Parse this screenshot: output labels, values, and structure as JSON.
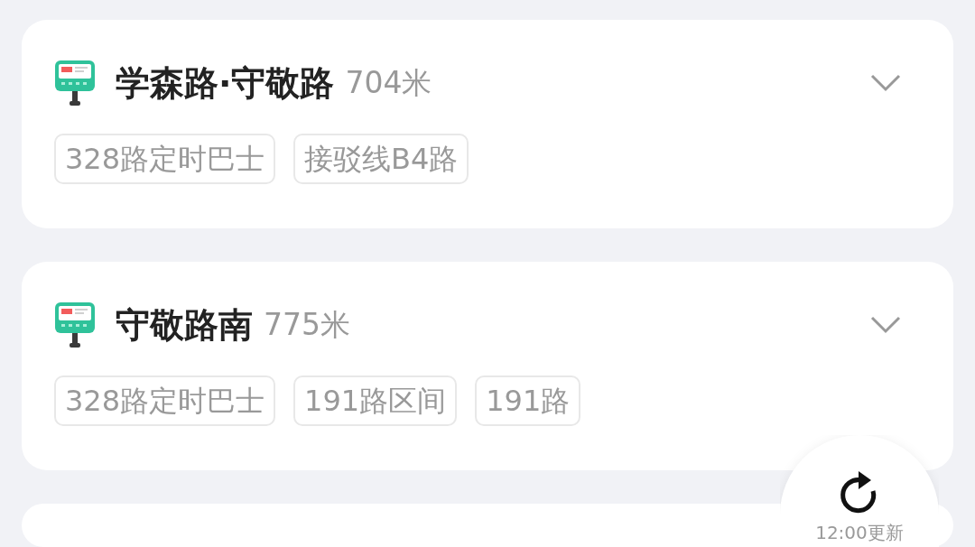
{
  "stops": [
    {
      "name": "学森路·守敬路",
      "distance": "704米",
      "expanded": false,
      "routes": [
        "328路定时巴士",
        "接驳线B4路"
      ]
    },
    {
      "name": "守敬路南",
      "distance": "775米",
      "expanded": false,
      "routes": [
        "328路定时巴士",
        "191路区间",
        "191路"
      ]
    },
    {
      "kind": "partial"
    }
  ],
  "refresh": {
    "label": "12:00更新"
  }
}
